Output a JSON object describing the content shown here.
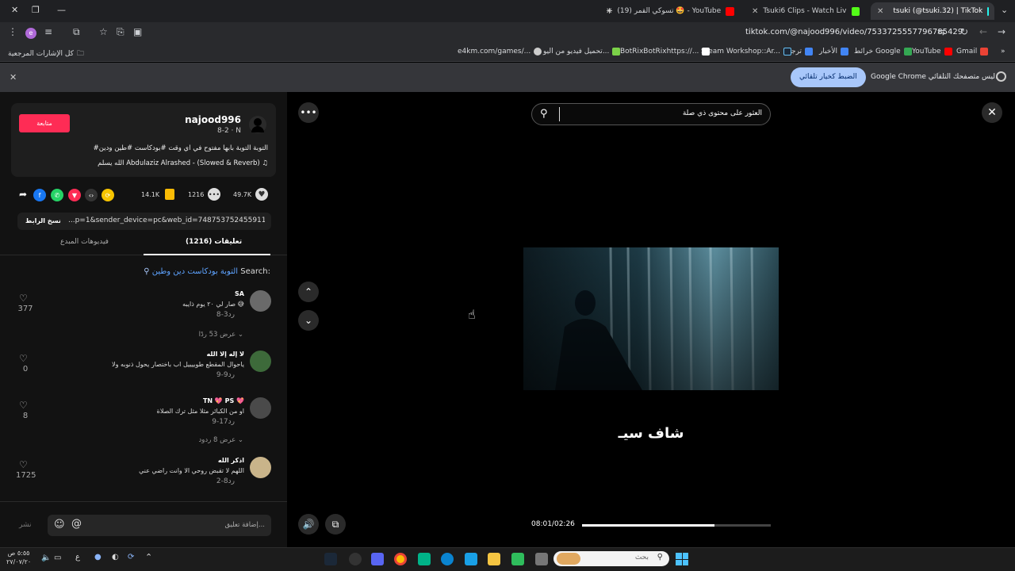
{
  "browser": {
    "tabs": [
      {
        "title": "tsuki (@tsuki.32) | TikTok",
        "active": true
      },
      {
        "title": "Tsuki6 Clips - Watch Live on Kick",
        "active": false
      },
      {
        "title": "(19) تسوكي القمر 🤩 - YouTube",
        "active": false
      }
    ],
    "url": "tiktok.com/@najood996/video/7533725557796785429",
    "bookmarks": [
      {
        "label": "Gmail",
        "color": "#ea4335"
      },
      {
        "label": "YouTube",
        "color": "#ff0000"
      },
      {
        "label": "خرائط Google",
        "color": "#34a853"
      },
      {
        "label": "الأخبار",
        "color": "#4285f4"
      },
      {
        "label": "ترجمة",
        "color": "#4285f4"
      },
      {
        "label": "Steam Workshop::Ar...",
        "color": "#1b2838"
      },
      {
        "label": "BotRixBotRixhttps://...",
        "color": "#ffffff"
      },
      {
        "label": "تحميل فيديو من اليو...",
        "color": "#7bd148"
      },
      {
        "label": "e4km.com/games/...",
        "color": "#cccccc"
      }
    ],
    "all_bookmarks": "كل الإشارات المرجعية",
    "infobar": {
      "message": "Google Chrome ليس متصفحك التلقائي.",
      "button": "الضبط كخيار تلقائي"
    }
  },
  "creator": {
    "username": "najood996",
    "meta": "8-2 · N",
    "follow_label": "متابعة",
    "caption": "#التوبة التوبة بابها مفتوح في اي وقت #بودكاست #طين ودين",
    "music": "الله يسلم  Abdulaziz Alrashed - (Slowed & Reverb)"
  },
  "actions": {
    "likes": "49.7K",
    "comments": "1216",
    "saves": "14.1K"
  },
  "share_link": {
    "value": "...p=1&sender_device=pc&web_id=7487537524559119927",
    "copy_label": "نسخ الرابط"
  },
  "tabs": {
    "comments": "تعليقات (1216)",
    "creator_videos": "فيديوهات المبدع"
  },
  "search_suggestion": {
    "prefix": "Search:",
    "query": "التوبة بودكاست دين وطين"
  },
  "comments": [
    {
      "name": "SA",
      "text": "صار لي ٢٠ يوم ذايبه 😅",
      "date": "3-8",
      "reply": "رد",
      "likes": "377",
      "view_replies": "عرض 53 ردًا",
      "avatar": "#6a6a6a"
    },
    {
      "name": "لا إله إلا الله",
      "text": "ياحوال المقطع طوييييل اب باختصار يحول ذنوبه ولا",
      "date": "9-9",
      "reply": "رد",
      "likes": "0",
      "view_replies": "",
      "avatar": "#3d6a3a"
    },
    {
      "name": "TN 💖 PS 💖",
      "text": "او من الكبائر مثلا مثل ترك الصلاة",
      "date": "17-9",
      "reply": "رد",
      "likes": "8",
      "view_replies": "عرض 8 ردود",
      "avatar": "#4a4a4a"
    },
    {
      "name": "اذكر الله",
      "text": "اللهم لا تقبض روحي الا وانت راضي عني",
      "date": "8-2",
      "reply": "رد",
      "likes": "1725",
      "view_replies": "",
      "avatar": "#c9b48a"
    }
  ],
  "comment_input": {
    "placeholder": "إضافة تعليق...",
    "post_label": "نشر"
  },
  "video": {
    "search_placeholder": "العثور على محتوى ذي صلة",
    "subtitle": "شاف سيـ",
    "time": "08:01/02:26",
    "progress": 0.7
  },
  "taskbar": {
    "search_placeholder": "بحث",
    "time": "٥:٥٥ ص",
    "date": "٢٧/٠٧/٢٠",
    "lang": "ع"
  },
  "colors": {
    "accent": "#fe2c55",
    "chrome_blue": "#a8c7fa"
  }
}
